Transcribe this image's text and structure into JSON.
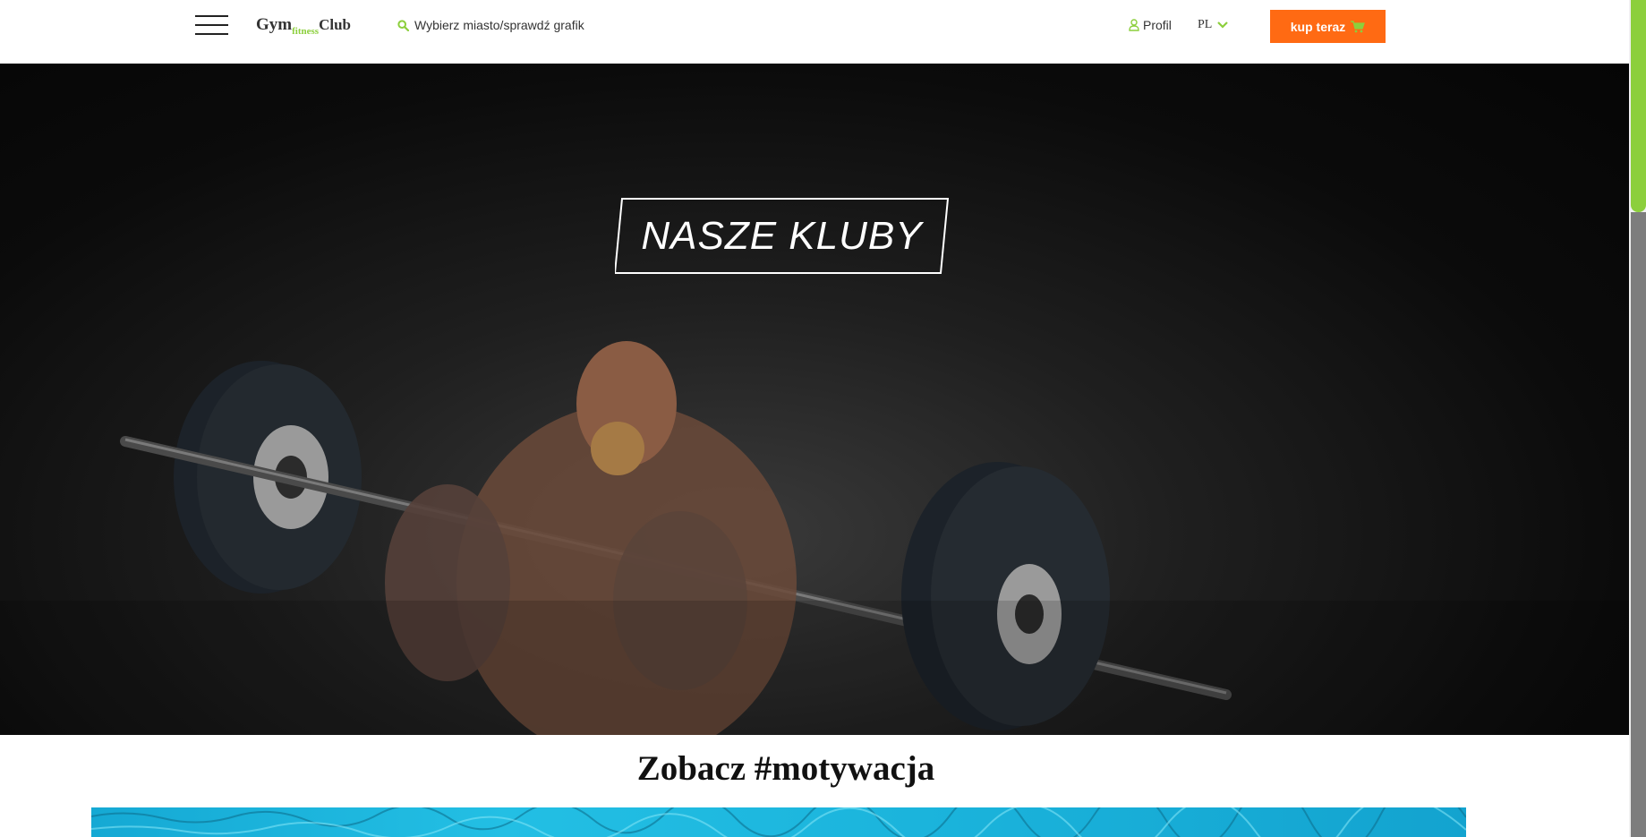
{
  "header": {
    "logo": {
      "gym": "Gym",
      "fitness": "fitness",
      "club": "Club"
    },
    "search": {
      "label": "Wybierz miasto/sprawdź grafik",
      "icon": "search-icon"
    },
    "profile": {
      "label": "Profil",
      "icon": "user-icon"
    },
    "language": {
      "value": "PL",
      "icon": "chevron-down-icon"
    },
    "buy_button": {
      "label": "kup teraz",
      "icon": "cart-icon"
    }
  },
  "hero": {
    "title": "NASZE KLUBY"
  },
  "section": {
    "title": "Zobacz #motywacja"
  },
  "colors": {
    "accent_green": "#8ccf3c",
    "buy_orange": "#ff6a13",
    "pool_blue": "#1bb4dc"
  }
}
